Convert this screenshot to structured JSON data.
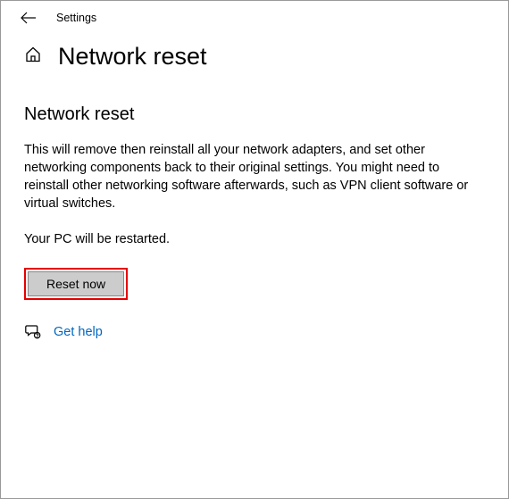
{
  "titlebar": {
    "app_name": "Settings"
  },
  "header": {
    "title": "Network reset"
  },
  "section": {
    "heading": "Network reset",
    "description": "This will remove then reinstall all your network adapters, and set other networking components back to their original settings. You might need to reinstall other networking software afterwards, such as VPN client software or virtual switches.",
    "restart_notice": "Your PC will be restarted."
  },
  "actions": {
    "reset_label": "Reset now"
  },
  "help": {
    "label": "Get help"
  }
}
